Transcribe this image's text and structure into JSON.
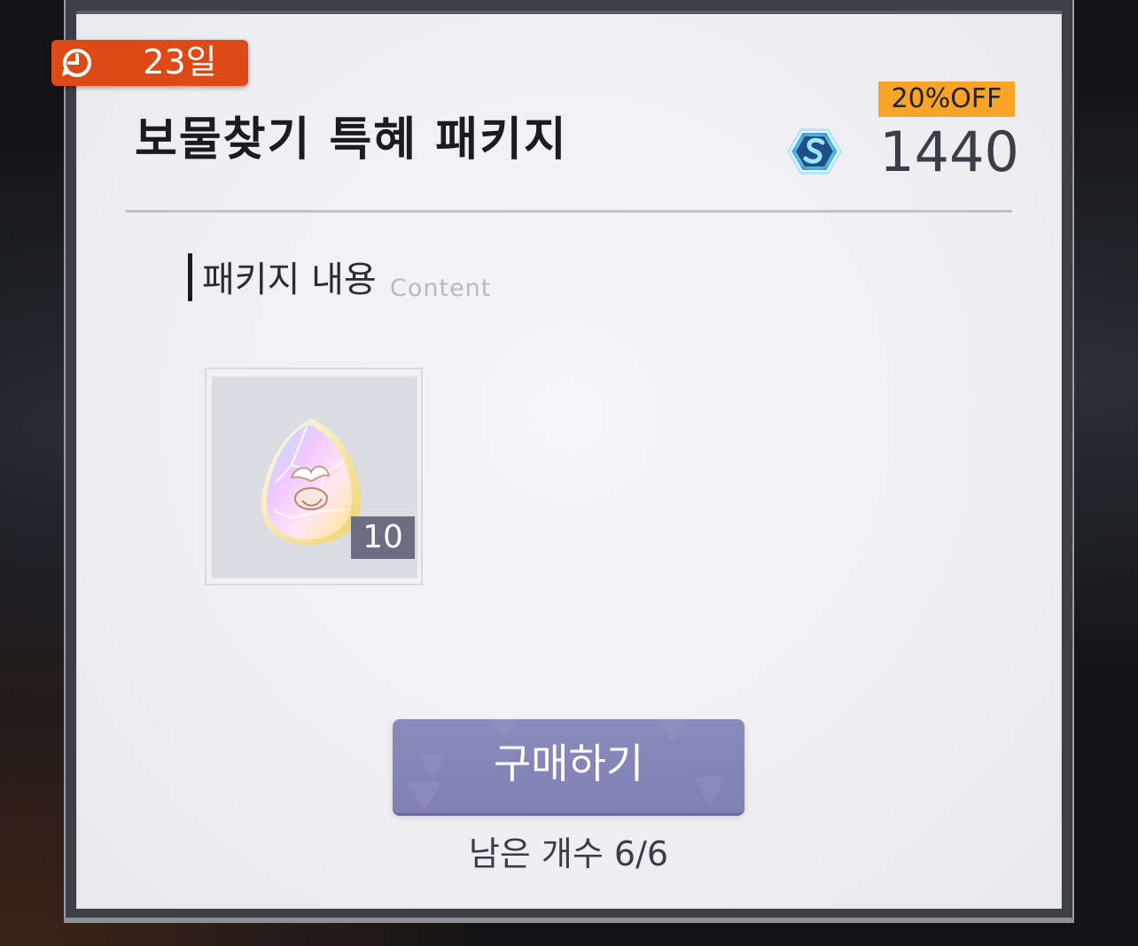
{
  "timer": {
    "label": "23일",
    "icon": "clock-icon"
  },
  "package": {
    "title": "보물찾기 특혜 패키지",
    "discount_label": "20%OFF",
    "price": "1440",
    "currency_icon": "s-gem-currency-icon"
  },
  "contents_section": {
    "heading": "패키지 내용",
    "subheading": "Content",
    "items": [
      {
        "icon": "rainbow-egg-icon",
        "quantity": "10"
      }
    ]
  },
  "purchase": {
    "button_label": "구매하기",
    "remaining": "남은 개수 6/6"
  },
  "colors": {
    "timer_badge": "#dd4a16",
    "discount_badge": "#f8a428",
    "button": "#8486b8",
    "card": "#f2f2f4"
  }
}
